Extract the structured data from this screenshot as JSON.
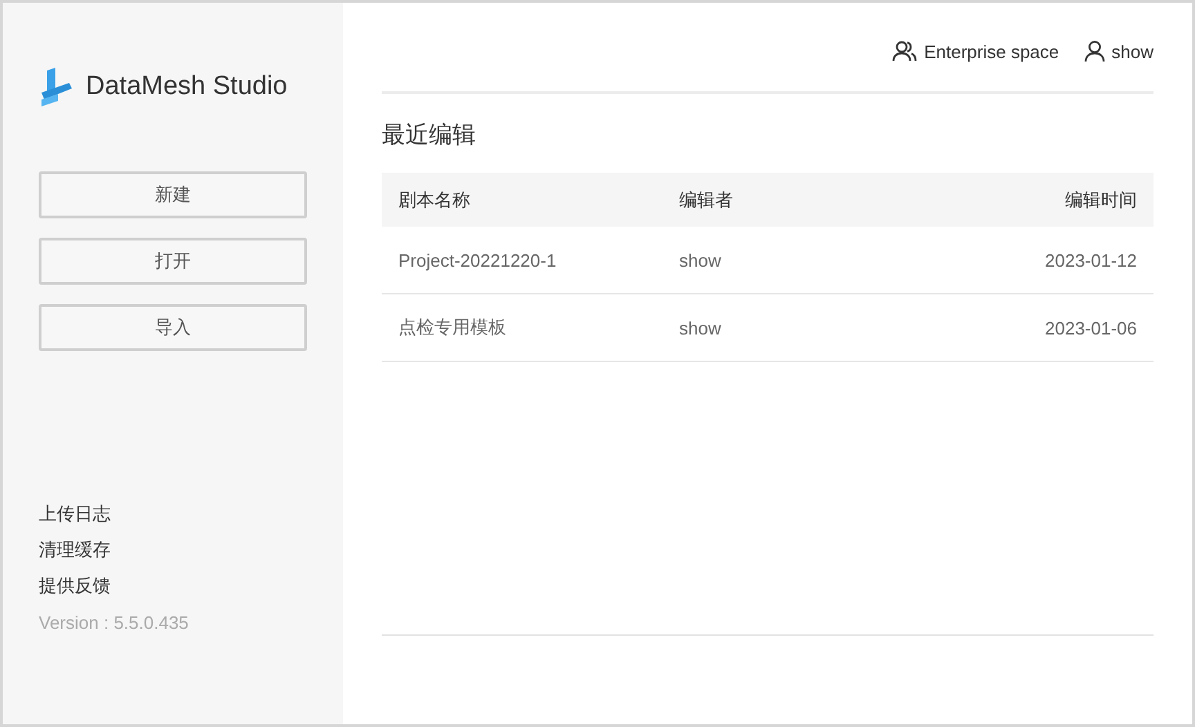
{
  "sidebar": {
    "app_name": "DataMesh Studio",
    "buttons": [
      "新建",
      "打开",
      "导入"
    ],
    "links": [
      "上传日志",
      "清理缓存",
      "提供反馈"
    ],
    "version": "Version : 5.5.0.435"
  },
  "header": {
    "space": "Enterprise space",
    "user": "show"
  },
  "section_title": "最近编辑",
  "table": {
    "columns": [
      "剧本名称",
      "编辑者",
      "编辑时间"
    ],
    "rows": [
      {
        "name": "Project-20221220-1",
        "editor": "show",
        "time": "2023-01-12"
      },
      {
        "name": "点检专用模板",
        "editor": "show",
        "time": "2023-01-06"
      }
    ]
  }
}
